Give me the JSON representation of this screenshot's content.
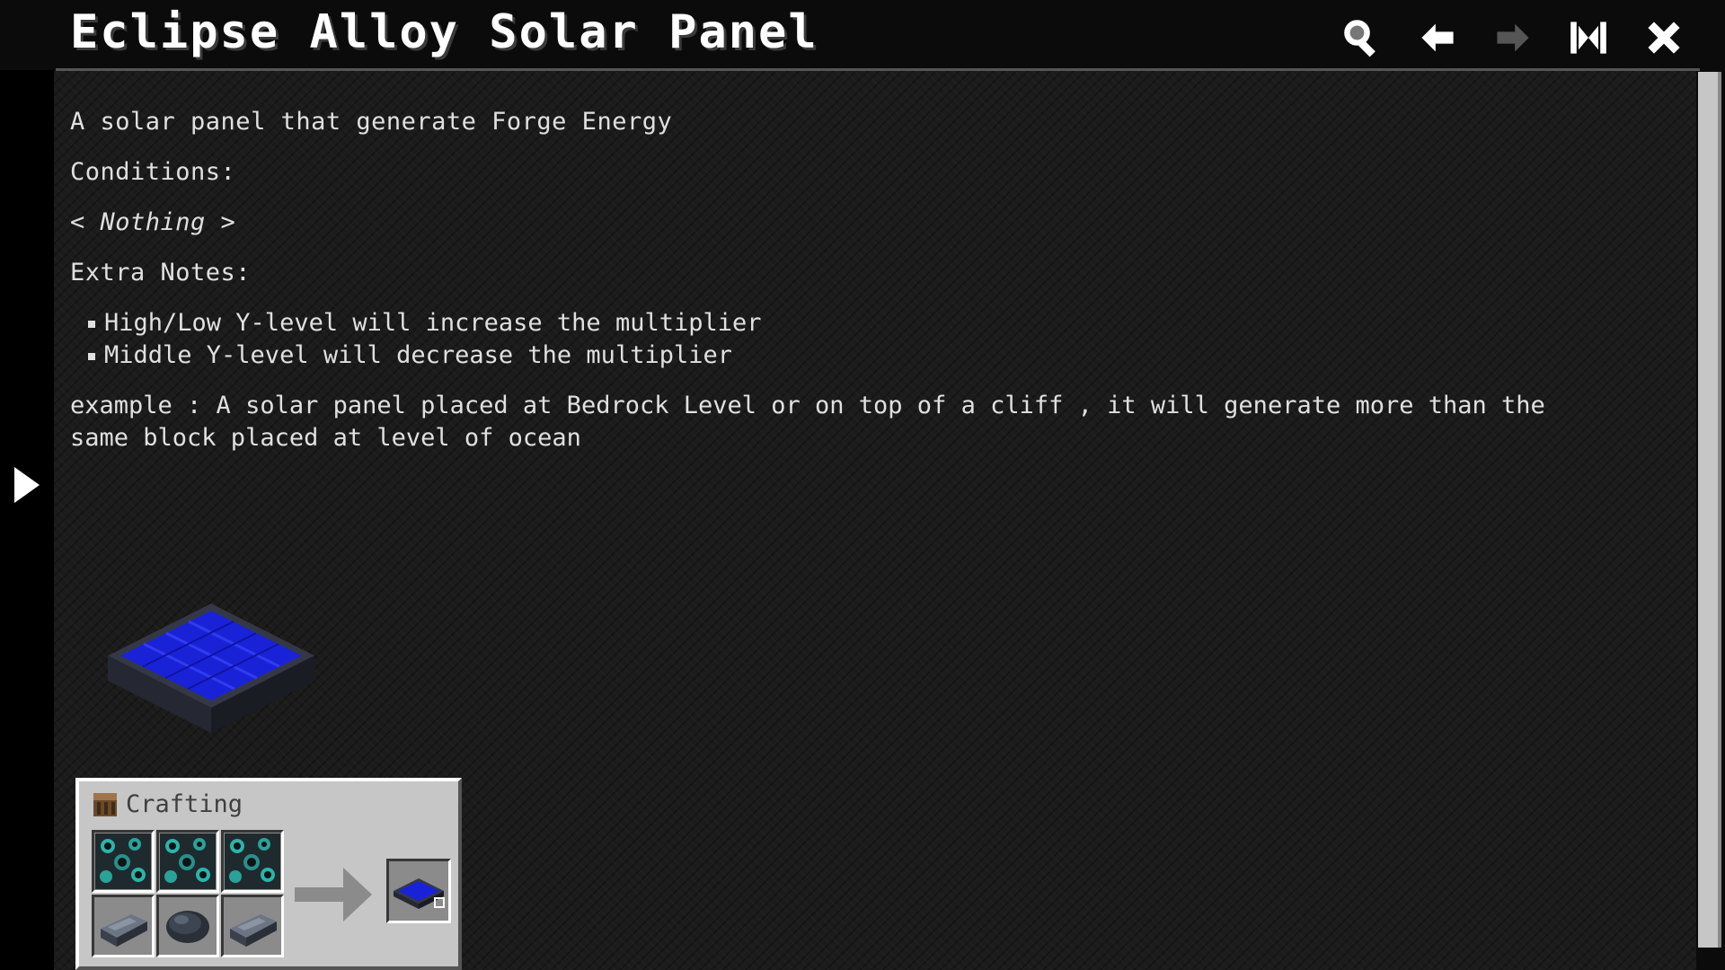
{
  "header": {
    "title": "Eclipse Alloy Solar Panel",
    "tools": [
      "search-icon",
      "back-arrow-icon",
      "forward-arrow-icon",
      "bookmark-icon",
      "close-icon"
    ]
  },
  "content": {
    "description": "A solar panel that generate Forge Energy",
    "conditions_label": "Conditions:",
    "conditions_value": "< Nothing >",
    "extra_notes_label": "Extra Notes:",
    "notes": [
      "High/Low Y-level will increase the multiplier",
      "Middle Y-level will decrease the multiplier"
    ],
    "example": "example : A solar panel placed at Bedrock Level or on top of a cliff , it will generate more than the same block placed at level of ocean"
  },
  "crafting": {
    "title": "Crafting",
    "ingredients": [
      "eclipse-ore",
      "eclipse-ore",
      "eclipse-ore",
      "alloy-ingot",
      "alloy-nugget",
      "alloy-ingot"
    ],
    "result": "eclipse-alloy-solar-panel"
  },
  "colors": {
    "panel_blue": "#1a22d8",
    "frame": "#2e3240",
    "ore": "#2fd6c9"
  }
}
